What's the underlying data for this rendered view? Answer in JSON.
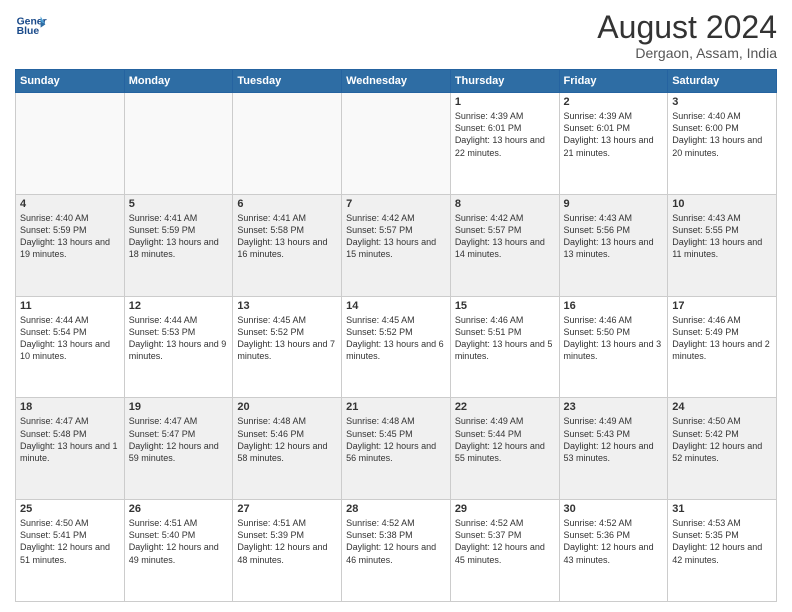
{
  "header": {
    "logo_line1": "General",
    "logo_line2": "Blue",
    "month_year": "August 2024",
    "location": "Dergaon, Assam, India"
  },
  "days_of_week": [
    "Sunday",
    "Monday",
    "Tuesday",
    "Wednesday",
    "Thursday",
    "Friday",
    "Saturday"
  ],
  "weeks": [
    [
      {
        "day": "",
        "info": ""
      },
      {
        "day": "",
        "info": ""
      },
      {
        "day": "",
        "info": ""
      },
      {
        "day": "",
        "info": ""
      },
      {
        "day": "1",
        "info": "Sunrise: 4:39 AM\nSunset: 6:01 PM\nDaylight: 13 hours\nand 22 minutes."
      },
      {
        "day": "2",
        "info": "Sunrise: 4:39 AM\nSunset: 6:01 PM\nDaylight: 13 hours\nand 21 minutes."
      },
      {
        "day": "3",
        "info": "Sunrise: 4:40 AM\nSunset: 6:00 PM\nDaylight: 13 hours\nand 20 minutes."
      }
    ],
    [
      {
        "day": "4",
        "info": "Sunrise: 4:40 AM\nSunset: 5:59 PM\nDaylight: 13 hours\nand 19 minutes."
      },
      {
        "day": "5",
        "info": "Sunrise: 4:41 AM\nSunset: 5:59 PM\nDaylight: 13 hours\nand 18 minutes."
      },
      {
        "day": "6",
        "info": "Sunrise: 4:41 AM\nSunset: 5:58 PM\nDaylight: 13 hours\nand 16 minutes."
      },
      {
        "day": "7",
        "info": "Sunrise: 4:42 AM\nSunset: 5:57 PM\nDaylight: 13 hours\nand 15 minutes."
      },
      {
        "day": "8",
        "info": "Sunrise: 4:42 AM\nSunset: 5:57 PM\nDaylight: 13 hours\nand 14 minutes."
      },
      {
        "day": "9",
        "info": "Sunrise: 4:43 AM\nSunset: 5:56 PM\nDaylight: 13 hours\nand 13 minutes."
      },
      {
        "day": "10",
        "info": "Sunrise: 4:43 AM\nSunset: 5:55 PM\nDaylight: 13 hours\nand 11 minutes."
      }
    ],
    [
      {
        "day": "11",
        "info": "Sunrise: 4:44 AM\nSunset: 5:54 PM\nDaylight: 13 hours\nand 10 minutes."
      },
      {
        "day": "12",
        "info": "Sunrise: 4:44 AM\nSunset: 5:53 PM\nDaylight: 13 hours\nand 9 minutes."
      },
      {
        "day": "13",
        "info": "Sunrise: 4:45 AM\nSunset: 5:52 PM\nDaylight: 13 hours\nand 7 minutes."
      },
      {
        "day": "14",
        "info": "Sunrise: 4:45 AM\nSunset: 5:52 PM\nDaylight: 13 hours\nand 6 minutes."
      },
      {
        "day": "15",
        "info": "Sunrise: 4:46 AM\nSunset: 5:51 PM\nDaylight: 13 hours\nand 5 minutes."
      },
      {
        "day": "16",
        "info": "Sunrise: 4:46 AM\nSunset: 5:50 PM\nDaylight: 13 hours\nand 3 minutes."
      },
      {
        "day": "17",
        "info": "Sunrise: 4:46 AM\nSunset: 5:49 PM\nDaylight: 13 hours\nand 2 minutes."
      }
    ],
    [
      {
        "day": "18",
        "info": "Sunrise: 4:47 AM\nSunset: 5:48 PM\nDaylight: 13 hours\nand 1 minute."
      },
      {
        "day": "19",
        "info": "Sunrise: 4:47 AM\nSunset: 5:47 PM\nDaylight: 12 hours\nand 59 minutes."
      },
      {
        "day": "20",
        "info": "Sunrise: 4:48 AM\nSunset: 5:46 PM\nDaylight: 12 hours\nand 58 minutes."
      },
      {
        "day": "21",
        "info": "Sunrise: 4:48 AM\nSunset: 5:45 PM\nDaylight: 12 hours\nand 56 minutes."
      },
      {
        "day": "22",
        "info": "Sunrise: 4:49 AM\nSunset: 5:44 PM\nDaylight: 12 hours\nand 55 minutes."
      },
      {
        "day": "23",
        "info": "Sunrise: 4:49 AM\nSunset: 5:43 PM\nDaylight: 12 hours\nand 53 minutes."
      },
      {
        "day": "24",
        "info": "Sunrise: 4:50 AM\nSunset: 5:42 PM\nDaylight: 12 hours\nand 52 minutes."
      }
    ],
    [
      {
        "day": "25",
        "info": "Sunrise: 4:50 AM\nSunset: 5:41 PM\nDaylight: 12 hours\nand 51 minutes."
      },
      {
        "day": "26",
        "info": "Sunrise: 4:51 AM\nSunset: 5:40 PM\nDaylight: 12 hours\nand 49 minutes."
      },
      {
        "day": "27",
        "info": "Sunrise: 4:51 AM\nSunset: 5:39 PM\nDaylight: 12 hours\nand 48 minutes."
      },
      {
        "day": "28",
        "info": "Sunrise: 4:52 AM\nSunset: 5:38 PM\nDaylight: 12 hours\nand 46 minutes."
      },
      {
        "day": "29",
        "info": "Sunrise: 4:52 AM\nSunset: 5:37 PM\nDaylight: 12 hours\nand 45 minutes."
      },
      {
        "day": "30",
        "info": "Sunrise: 4:52 AM\nSunset: 5:36 PM\nDaylight: 12 hours\nand 43 minutes."
      },
      {
        "day": "31",
        "info": "Sunrise: 4:53 AM\nSunset: 5:35 PM\nDaylight: 12 hours\nand 42 minutes."
      }
    ]
  ]
}
